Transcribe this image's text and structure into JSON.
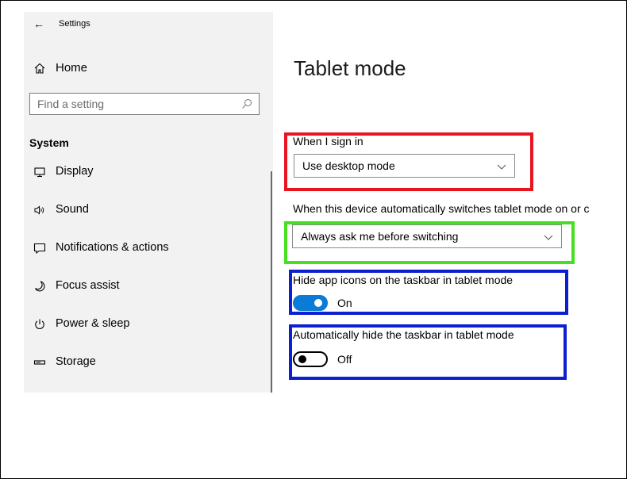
{
  "header": {
    "back_icon": "back-arrow-icon",
    "title": "Settings"
  },
  "sidebar": {
    "home": {
      "icon": "home-icon",
      "label": "Home"
    },
    "search": {
      "placeholder": "Find a setting",
      "icon": "search-icon"
    },
    "section": "System",
    "items": [
      {
        "icon": "display-icon",
        "label": "Display"
      },
      {
        "icon": "sound-icon",
        "label": "Sound"
      },
      {
        "icon": "notifications-icon",
        "label": "Notifications & actions"
      },
      {
        "icon": "focus-assist-icon",
        "label": "Focus assist"
      },
      {
        "icon": "power-icon",
        "label": "Power & sleep"
      },
      {
        "icon": "storage-icon",
        "label": "Storage"
      }
    ]
  },
  "main": {
    "title": "Tablet mode",
    "sign_in": {
      "label": "When I sign in",
      "value": "Use desktop mode"
    },
    "auto_switch": {
      "label": "When this device automatically switches tablet mode on or c",
      "value": "Always ask me before switching"
    },
    "hide_icons": {
      "label": "Hide app icons on the taskbar in tablet mode",
      "state": "On"
    },
    "hide_taskbar": {
      "label": "Automatically hide the taskbar in tablet mode",
      "state": "Off"
    }
  },
  "colors": {
    "highlight_red": "#e8141f",
    "highlight_green": "#45e020",
    "highlight_blue": "#0a1fd1",
    "toggle_on": "#0a7bd6"
  }
}
